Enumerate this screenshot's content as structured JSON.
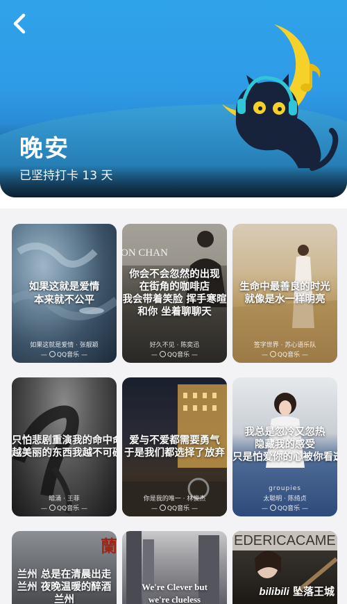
{
  "header": {
    "title": "晚安",
    "streak_text": "已坚持打卡 13 天"
  },
  "cards": [
    {
      "lyric": [
        "如果这就是爱情",
        "本来就不公平"
      ],
      "song": "如果这就是爱情 · 张靓颖",
      "brand": "QQ音乐"
    },
    {
      "lyric": [
        "你会不会忽然的出现",
        "在街角的咖啡店",
        "我会带着笑脸 挥手寒暄",
        "和你 坐着聊聊天"
      ],
      "song": "好久不见 · 陈奕迅",
      "brand": "QQ音乐",
      "photo_text": "ON CHAN"
    },
    {
      "lyric": [
        "生命中最善良的时光",
        "就像是水一样明亮"
      ],
      "song": "签字世界 · 苏心语乐队",
      "brand": "QQ音乐"
    },
    {
      "lyric": [
        "只怕悲剧重演我的命中命中",
        "越美丽的东西我越不可碰"
      ],
      "song": "暗涌 · 王菲",
      "brand": "QQ音乐"
    },
    {
      "lyric": [
        "爱与不爱都需要勇气",
        "于是我们都选择了放弃"
      ],
      "song": "你是我的唯一 · 林俊杰",
      "brand": "QQ音乐"
    },
    {
      "lyric": [
        "我总是忽冷又忽热",
        "隐藏我的感受",
        "只是怕爱你的心被你看透"
      ],
      "song": "太聪明 · 陈绮贞",
      "brand": "QQ音乐",
      "album_text": "groupies"
    },
    {
      "lyric": [
        "兰州 总是在清晨出走",
        "兰州 夜晚温暖的醉酒",
        "兰州"
      ],
      "photo_text": "蘭"
    },
    {
      "lyric": [
        "We're Clever but",
        "we're clueless"
      ]
    },
    {
      "lyric": [],
      "photo_text": "EDERICACAME"
    }
  ],
  "watermark": {
    "brand": "bilibili",
    "user": "坠落王城"
  }
}
